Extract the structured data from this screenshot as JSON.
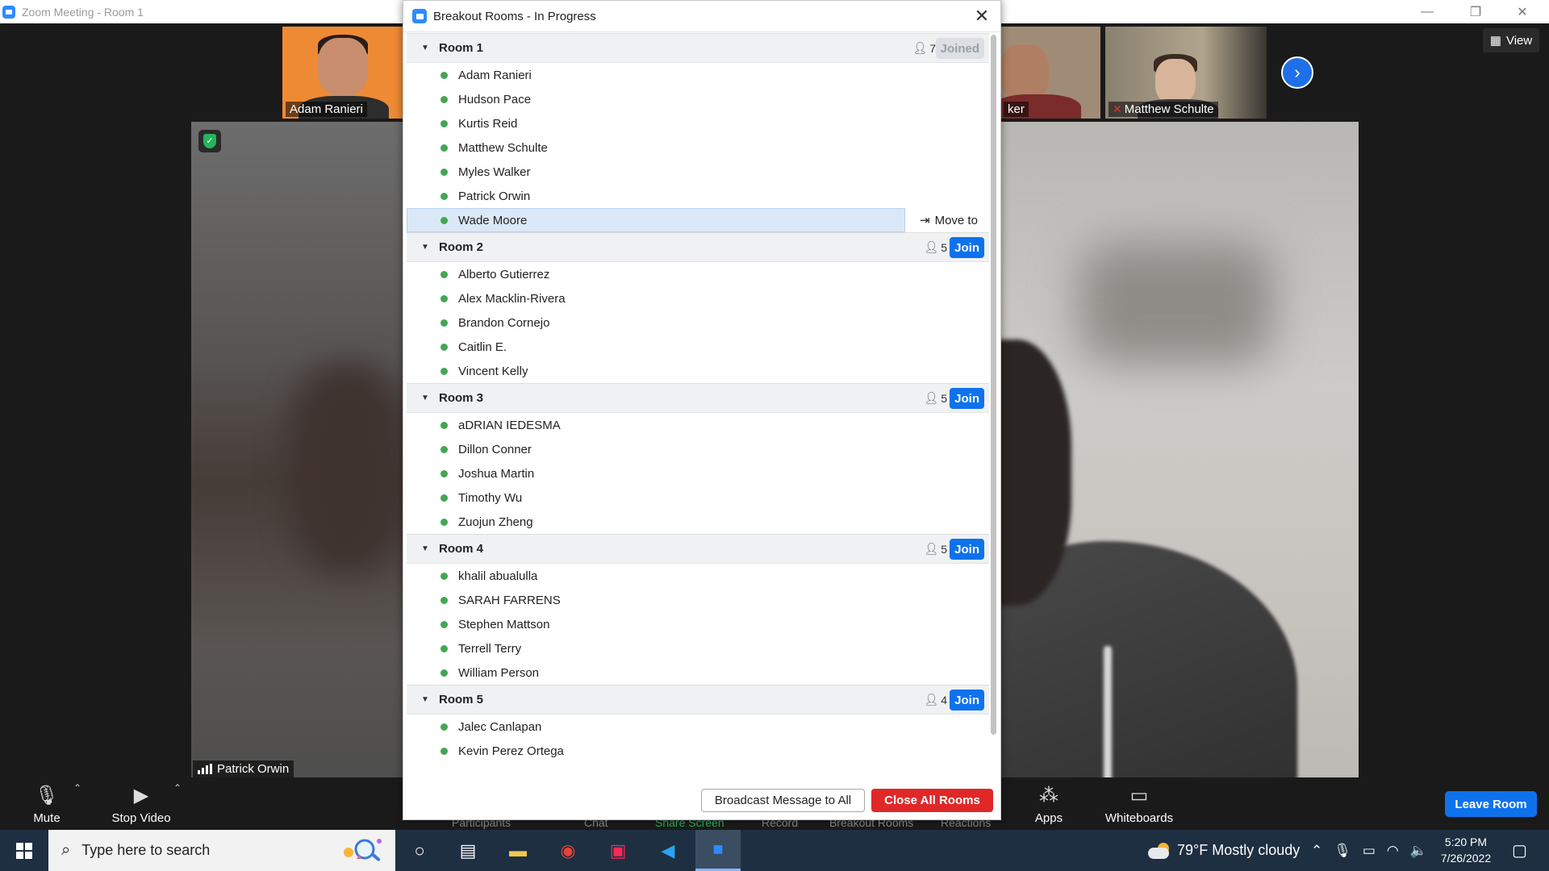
{
  "window": {
    "title": "Zoom Meeting - Room 1",
    "controls": {
      "minimize": "—",
      "restore": "❐",
      "close": "✕"
    }
  },
  "meeting": {
    "thumbnails": [
      {
        "name": "Adam Ranieri"
      },
      {
        "name": "ker"
      },
      {
        "name": "Matthew Schulte",
        "muted": true
      }
    ],
    "view_label": "View",
    "main_video_left": {
      "name": "Patrick Orwin"
    }
  },
  "dialog": {
    "title": "Breakout Rooms - In Progress",
    "rooms": [
      {
        "name": "Room 1",
        "count": "7",
        "action": "Joined",
        "joined": true,
        "members": [
          "Adam Ranieri",
          "Hudson Pace",
          "Kurtis Reid",
          "Matthew Schulte",
          "Myles Walker",
          "Patrick Orwin",
          "Wade Moore"
        ]
      },
      {
        "name": "Room 2",
        "count": "5",
        "action": "Join",
        "joined": false,
        "members": [
          "Alberto Gutierrez",
          "Alex Macklin-Rivera",
          "Brandon Cornejo",
          "Caitlin E.",
          "Vincent Kelly"
        ]
      },
      {
        "name": "Room 3",
        "count": "5",
        "action": "Join",
        "joined": false,
        "members": [
          "aDRIAN IEDESMA",
          "Dillon Conner",
          "Joshua Martin",
          "Timothy Wu",
          "Zuojun Zheng"
        ]
      },
      {
        "name": "Room 4",
        "count": "5",
        "action": "Join",
        "joined": false,
        "members": [
          "khalil abualulla",
          "SARAH FARRENS",
          "Stephen Mattson",
          "Terrell Terry",
          "William Person"
        ]
      },
      {
        "name": "Room 5",
        "count": "4",
        "action": "Join",
        "joined": false,
        "members": [
          "Jalec Canlapan",
          "Kevin Perez Ortega"
        ]
      }
    ],
    "selected_member": "Wade Moore",
    "move_to_label": "Move to",
    "broadcast_label": "Broadcast Message to All",
    "close_all_label": "Close All Rooms"
  },
  "toolbar": {
    "mute_label": "Mute",
    "stop_video_label": "Stop Video",
    "participants_label": "Participants",
    "chat_label": "Chat",
    "share_screen_label": "Share Screen",
    "record_label": "Record",
    "breakout_rooms_label": "Breakout Rooms",
    "reactions_label": "Reactions",
    "apps_label": "Apps",
    "whiteboards_label": "Whiteboards",
    "leave_room_label": "Leave Room"
  },
  "taskbar": {
    "search_placeholder": "Type here to search",
    "weather": "79°F  Mostly cloudy",
    "time": "5:20 PM",
    "date": "7/26/2022"
  },
  "colors": {
    "zoom_blue": "#0e72ed",
    "close_red": "#e02828",
    "online_green": "#43a653"
  }
}
